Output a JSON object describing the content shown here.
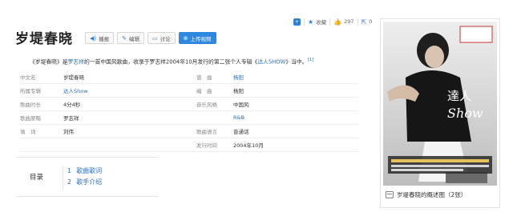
{
  "toolbar": {
    "collect": "收藏",
    "likes": "297",
    "shares": "0"
  },
  "title": "岁堤春晓",
  "actions": {
    "play": "播报",
    "edit": "编辑",
    "discuss": "讨论",
    "upload": "上传视频"
  },
  "summary": {
    "pre": "《岁堤春晓》是",
    "singer": "罗志祥",
    "mid": "的一首中国风歌曲，收录于罗志祥2004年10月发行的第二张个人专辑《",
    "album": "达人SHOW",
    "post": "》当中。",
    "ref": "[1]"
  },
  "info": {
    "rows": [
      {
        "k": "中文名",
        "v": "岁堤春晓",
        "k2": "谱　曲",
        "v2": "杨阳"
      },
      {
        "k": "所属专辑",
        "v": "达人Show",
        "k2": "编　曲",
        "v2": "杨阳"
      },
      {
        "k": "歌曲时长",
        "v": "4分4秒",
        "k2": "音乐风格",
        "v2": "中国风"
      },
      {
        "k": "歌曲原唱",
        "v": "罗志祥",
        "k2": "",
        "v2": "R&B"
      },
      {
        "k": "填　词",
        "v": "刘伟",
        "k2": "歌曲语言",
        "v2": "普通话"
      },
      {
        "k": "",
        "v": "",
        "k2": "发行时间",
        "v2": "2004年10月"
      }
    ]
  },
  "toc": {
    "label": "目录",
    "items": [
      {
        "num": "1",
        "text": "歌曲歌词"
      },
      {
        "num": "2",
        "text": "歌手介绍"
      }
    ]
  },
  "card": {
    "caption": "岁堤春晓的概述图（2张）",
    "cover_text_1": "達人",
    "cover_text_2": "Show"
  }
}
